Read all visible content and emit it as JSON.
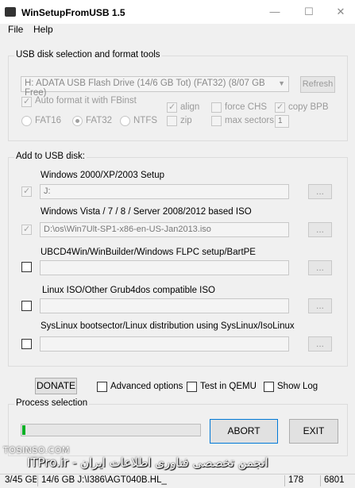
{
  "window": {
    "title": "WinSetupFromUSB 1.5"
  },
  "menu": {
    "file": "File",
    "help": "Help"
  },
  "usb_group": {
    "title": "USB disk selection and format tools",
    "disk_selected": "H: ADATA USB Flash Drive (14/6 GB Tot) (FAT32) (8/07 GB Free)",
    "refresh": "Refresh",
    "auto_format": "Auto format it with FBinst",
    "fs_fat16": "FAT16",
    "fs_fat32": "FAT32",
    "fs_ntfs": "NTFS",
    "align": "align",
    "zip": "zip",
    "force_chs": "force CHS",
    "max_sectors": "max sectors",
    "copy_bpb": "copy BPB",
    "bpb_value": "1"
  },
  "add_group": {
    "title": "Add to USB disk:",
    "items": [
      {
        "label": "Windows 2000/XP/2003 Setup",
        "path": "J:",
        "browse": "...",
        "checked": true
      },
      {
        "label": "Windows Vista / 7 / 8 / Server 2008/2012 based ISO",
        "path": "D:\\os\\Win7Ult-SP1-x86-en-US-Jan2013.iso",
        "browse": "...",
        "checked": true
      },
      {
        "label": "UBCD4Win/WinBuilder/Windows FLPC setup/BartPE",
        "path": "",
        "browse": "...",
        "checked": false
      },
      {
        "label": "Linux ISO/Other Grub4dos compatible ISO",
        "path": "",
        "browse": "...",
        "checked": false
      },
      {
        "label": "SysLinux bootsector/Linux distribution using SysLinux/IsoLinux",
        "path": "",
        "browse": "...",
        "checked": false
      }
    ]
  },
  "options": {
    "donate": "DONATE",
    "advanced": "Advanced options",
    "test_qemu": "Test in QEMU",
    "show_log": "Show Log"
  },
  "process": {
    "title": "Process selection",
    "progress_fraction": 0.02,
    "abort": "ABORT",
    "exit": "EXIT"
  },
  "watermark": {
    "site": "TOSINSO.COM",
    "text": "ITPro.ir - انجمن تخصصی فناوری اطلاعات ایران"
  },
  "status": {
    "seg1": "3/45 GB",
    "seg2": "14/6 GB J:\\I386\\AGT040B.HL_",
    "seg3": "178",
    "seg4": "6801"
  },
  "colors": {
    "progress": "#06b025",
    "accent_border": "#0078d7"
  }
}
